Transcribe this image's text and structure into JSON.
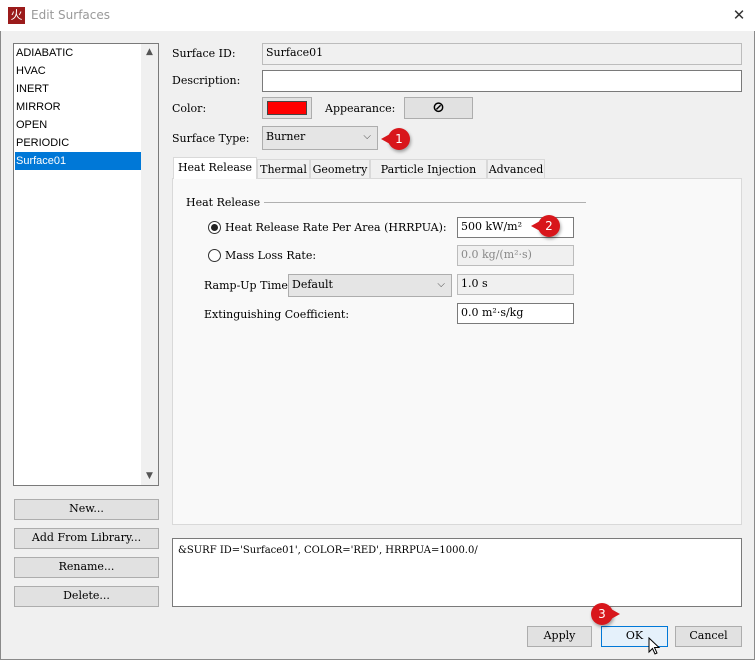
{
  "window": {
    "title": "Edit Surfaces",
    "app_icon": "火",
    "close": "✕"
  },
  "surface_list": {
    "items": [
      "ADIABATIC",
      "HVAC",
      "INERT",
      "MIRROR",
      "OPEN",
      "PERIODIC",
      "Surface01"
    ],
    "selected": "Surface01"
  },
  "list_buttons": {
    "new": "New...",
    "add_from_library": "Add From Library...",
    "rename": "Rename...",
    "delete": "Delete..."
  },
  "form": {
    "surface_id_label": "Surface ID:",
    "surface_id_value": "Surface01",
    "description_label": "Description:",
    "description_value": "",
    "color_label": "Color:",
    "color_value": "#ff0000",
    "appearance_label": "Appearance:",
    "appearance_icon": "⊘",
    "surface_type_label": "Surface Type:",
    "surface_type_value": "Burner"
  },
  "tabs": [
    "Heat Release",
    "Thermal",
    "Geometry",
    "Particle Injection",
    "Advanced"
  ],
  "heat_release": {
    "group_title": "Heat Release",
    "hrrpua_label": "Heat Release Rate Per Area (HRRPUA):",
    "hrrpua_value": "500 kW/m²",
    "mlr_label": "Mass Loss Rate:",
    "mlr_value": "0.0 kg/(m²·s)",
    "ramp_label": "Ramp-Up Time:",
    "ramp_select": "Default",
    "ramp_value": "1.0 s",
    "ext_label": "Extinguishing Coefficient:",
    "ext_value": "0.0 m²·s/kg",
    "selected": "hrrpua"
  },
  "preview": "&SURF ID='Surface01', COLOR='RED', HRRPUA=1000.0/",
  "footer": {
    "apply": "Apply",
    "ok": "OK",
    "cancel": "Cancel"
  },
  "annotations": [
    "1",
    "2",
    "3"
  ],
  "colors": {
    "accent": "#0078d7",
    "badge": "#d8161b"
  }
}
